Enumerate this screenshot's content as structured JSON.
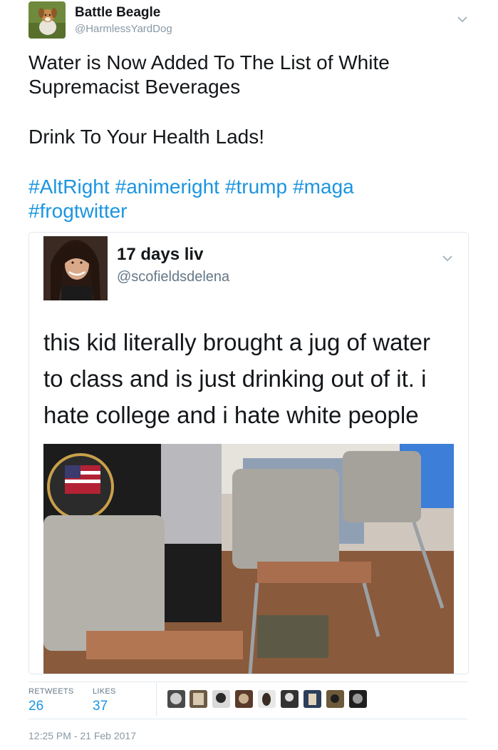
{
  "author": {
    "name": "Battle Beagle",
    "handle": "@HarmlessYardDog"
  },
  "tweet": {
    "lines": [
      "Water is Now Added To The List of White",
      "Supremacist Beverages",
      "Drink To Your Health Lads!"
    ],
    "hashtags": [
      "#AltRight",
      "#animeright",
      "#trump",
      "#maga",
      "#frogtwitter"
    ]
  },
  "quoted": {
    "name": "17 days liv",
    "handle": "@scofieldsdelena",
    "lines": [
      "this kid literally brought a jug of water",
      "to class and is just drinking out of it. i",
      "hate college and i hate white people"
    ]
  },
  "stats": {
    "retweets_label": "RETWEETS",
    "retweets": "26",
    "likes_label": "LIKES",
    "likes": "37"
  },
  "timestamp": "12:25 PM - 21 Feb 2017",
  "colors": {
    "link": "#1b95e0",
    "muted": "#8899a6",
    "border": "#e1e8ed"
  },
  "icons": [
    "chevron-down-icon",
    "chevron-down-icon"
  ]
}
